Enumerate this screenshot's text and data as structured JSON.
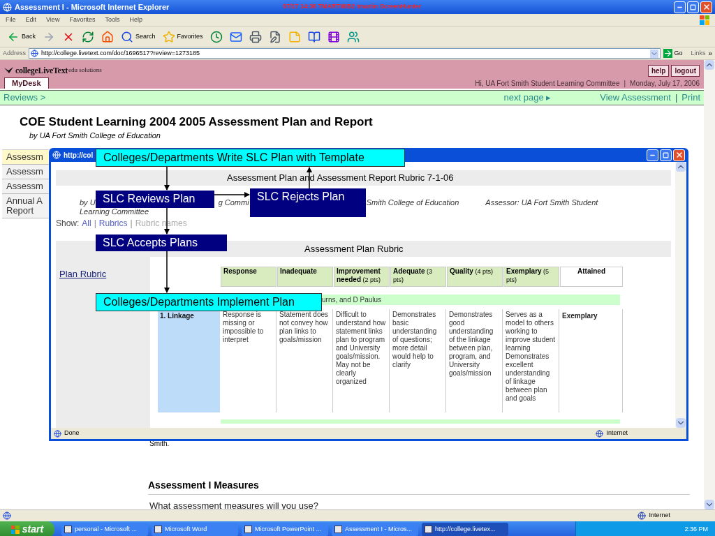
{
  "window": {
    "title": "Assessment I - Microsoft Internet Explorer",
    "caption": "07/17 14:36 TMARTIIIIB2 tmartin ScreenHunter"
  },
  "menu": [
    "File",
    "Edit",
    "View",
    "Favorites",
    "Tools",
    "Help"
  ],
  "toolbar": [
    {
      "kind": "back",
      "label": "Back"
    },
    {
      "kind": "forward"
    },
    {
      "kind": "stop"
    },
    {
      "kind": "refresh"
    },
    {
      "kind": "home"
    },
    {
      "kind": "search",
      "label": "Search"
    },
    {
      "kind": "favorites",
      "label": "Favorites"
    },
    {
      "kind": "history"
    },
    {
      "kind": "mail"
    },
    {
      "kind": "print"
    },
    {
      "kind": "edit"
    },
    {
      "kind": "note"
    },
    {
      "kind": "research"
    },
    {
      "kind": "media"
    },
    {
      "kind": "messenger"
    }
  ],
  "address": {
    "label": "Address",
    "url": "http://college.livetext.com/doc/1696517?review=1273185",
    "go": "Go",
    "links": "Links",
    "more": "»"
  },
  "site": {
    "logo": "collegeLiveText",
    "logo_suffix": "edu solutions",
    "buttons": [
      "help",
      "logout"
    ],
    "tab": "MyDesk",
    "greeting": "Hi, UA Fort Smith Student Learning Committee",
    "separator": "|",
    "date": "Monday, July 17, 2006"
  },
  "nav": {
    "breadcrumb": "Reviews >",
    "next": "next page ▸",
    "links": [
      "View Assessment",
      "Print"
    ],
    "separator": "|"
  },
  "document": {
    "title": "COE Student Learning 2004 2005 Assessment Plan and Report",
    "byline": "by UA Fort Smith College of Education"
  },
  "side_tabs": [
    {
      "label": "Assessm",
      "selected": true
    },
    {
      "label": "Assessm",
      "selected": false
    },
    {
      "label": "Assessm",
      "selected": false
    },
    {
      "label": "Annual A Report",
      "selected": false
    }
  ],
  "popup": {
    "title": "http://col",
    "heading": "Assessment Plan and Assessment Report Rubric 7-1-06",
    "byline_parts": [
      "by U",
      "g Commi",
      "Smith College of Education"
    ],
    "byline_end": "Learning Committee",
    "assessor": "Assessor: UA Fort Smith Student",
    "show_label": "Show:",
    "show_links": [
      "All",
      "Rubrics",
      "Rubric names"
    ],
    "show_separator": "|",
    "section": "Assessment Plan Rubric",
    "side_link": "Plan Rubric",
    "columns": [
      {
        "label": "Response"
      },
      {
        "label": "Inadequate"
      },
      {
        "label": "Improvement needed",
        "points": "(2 pts)"
      },
      {
        "label": "Adequate",
        "points": "(3 pts)"
      },
      {
        "label": "Quality",
        "points": "(4 pts)"
      },
      {
        "label": "Exemplary",
        "points": "(5 pts)"
      },
      {
        "label": "Attained"
      }
    ],
    "group_row": "urns, and D Paulus",
    "row": {
      "criterion": "1. Linkage",
      "cells": [
        "Response is missing or impossible to interpret",
        "Statement does not convey how plan links to goals/mission",
        "Difficult to understand how statement links plan to program and University goals/mission. May not be clearly organized",
        "Demonstrates basic understanding of questions; more detail would help to clarify",
        "Demonstrates good understanding of the linkage between plan, program, and University goals/mission",
        "Serves as a model to others working to improve student learning Demonstrates excellent understanding of linkage between plan and goals"
      ],
      "attained": "Exemplary"
    },
    "status": "Done",
    "zone": "Internet"
  },
  "flowchart": [
    {
      "text": "Colleges/Departments Write SLC Plan with Template",
      "kind": "action"
    },
    {
      "text": "SLC Reviews Plan",
      "kind": "review"
    },
    {
      "text": "SLC Rejects Plan",
      "kind": "review"
    },
    {
      "text": "SLC Accepts Plans",
      "kind": "review"
    },
    {
      "text": "Colleges/Departments Implement Plan",
      "kind": "action"
    }
  ],
  "below": {
    "fragment": "Smith.",
    "heading": "Assessment I Measures",
    "question": "What assessment measures will you use?"
  },
  "status_bar": {
    "zone": "Internet"
  },
  "taskbar": {
    "start": "start",
    "items": [
      {
        "label": "personal - Microsoft ...",
        "selected": false
      },
      {
        "label": "Microsoft Word",
        "selected": false
      },
      {
        "label": "Microsoft PowerPoint ...",
        "selected": false
      },
      {
        "label": "Assessment I - Micros...",
        "selected": false
      },
      {
        "label": "http://college.livetex...",
        "selected": true
      }
    ],
    "clock": "2:36 PM"
  }
}
